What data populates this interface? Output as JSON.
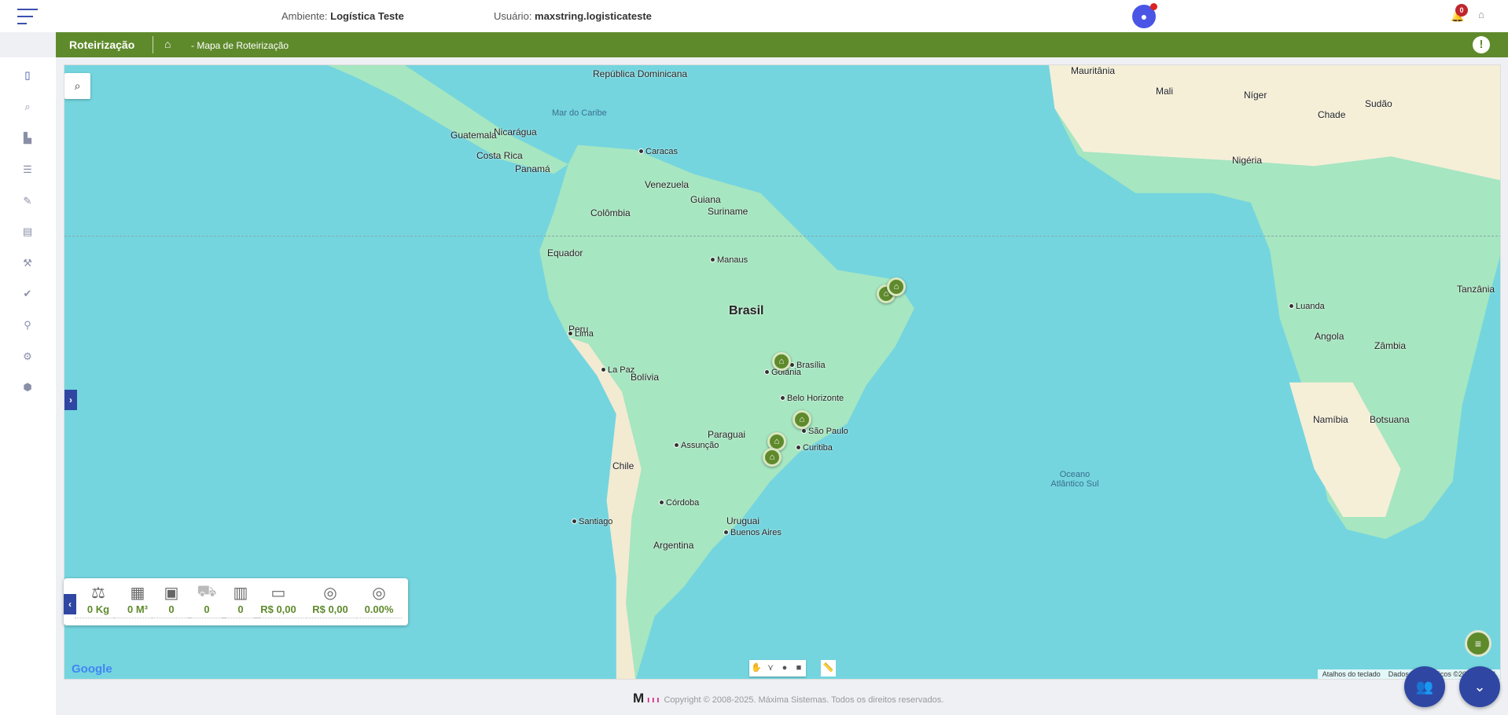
{
  "header": {
    "env_label": "Ambiente:",
    "env_value": "Logística Teste",
    "user_label": "Usuário:",
    "user_value": "maxstring.logisticateste",
    "notification_count": "0"
  },
  "breadcrumb": {
    "module": "Roteirização",
    "page": "- Mapa de Roteirização"
  },
  "sidebar": {
    "items": [
      "map-icon",
      "search-icon",
      "building-icon",
      "list-icon",
      "edit-icon",
      "document-icon",
      "tools-icon",
      "double-check-icon",
      "pin-icon",
      "gear-icon",
      "package-icon"
    ]
  },
  "map": {
    "countries": [
      "Brasil",
      "Bolívia",
      "Peru",
      "Colômbia",
      "Venezuela",
      "Equador",
      "Paraguai",
      "Chile",
      "Argentina",
      "Uruguai",
      "Guatemala",
      "Nicarágua",
      "Costa Rica",
      "Panamá",
      "República Dominicana",
      "Mauritânia",
      "Mali",
      "Níger",
      "Chade",
      "Sudão",
      "Nigéria",
      "Angola",
      "Namíbia",
      "Botsuana",
      "Zâmbia",
      "Tanzânia",
      "Guiana",
      "Suriname"
    ],
    "cities": [
      "Manaus",
      "Lima",
      "Brasília",
      "São Paulo",
      "Curitiba",
      "Belo Horizonte",
      "Goiânia",
      "La Paz",
      "Santiago",
      "Buenos Aires",
      "Córdoba",
      "Assunção",
      "Caracas",
      "Luanda"
    ],
    "seas": [
      "Oceano Atlântico Sul",
      "Mar do Caribe"
    ],
    "logo": "Google",
    "attribution": [
      "Atalhos do teclado",
      "Dados cartográficos ©2025 INEGI"
    ],
    "ocean_color": "#74d5df",
    "land_color": "#a6e6c0"
  },
  "summary": [
    {
      "icon": "weight-icon",
      "value": "0 Kg"
    },
    {
      "icon": "boxes-icon",
      "value": "0 M³"
    },
    {
      "icon": "box-icon",
      "value": "0"
    },
    {
      "icon": "truck-icon",
      "value": "0"
    },
    {
      "icon": "packages-icon",
      "value": "0"
    },
    {
      "icon": "money-icon",
      "value": "R$ 0,00"
    },
    {
      "icon": "coin-icon",
      "value": "R$ 0,00"
    },
    {
      "icon": "coin-percent-icon",
      "value": "0.00%"
    }
  ],
  "footer": {
    "logo": "M",
    "copyright": "Copyright © 2008-2025. Máxima Sistemas. Todos os direitos reservados."
  },
  "colors": {
    "brand_green": "#5f8a2c",
    "brand_blue": "#2f47a3"
  }
}
